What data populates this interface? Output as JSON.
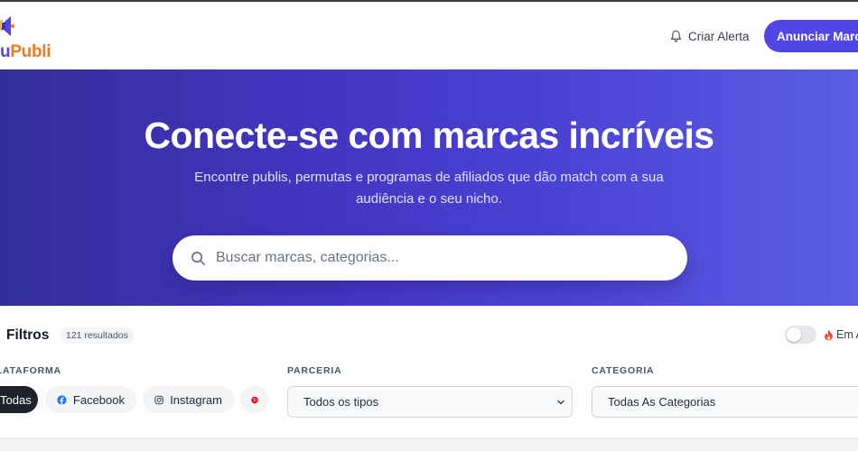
{
  "header": {
    "logo_text_prefix": "u",
    "logo_text": "Publi",
    "alert_label": "Criar Alerta",
    "announce_label": "Anunciar Marca"
  },
  "hero": {
    "title": "Conecte-se com marcas incríveis",
    "subtitle": "Encontre publis, permutas e programas de afiliados que dão match com a sua audiência e o seu nicho.",
    "search_placeholder": "Buscar marcas, categorias..."
  },
  "filters": {
    "title": "Filtros",
    "results": "121 resultados",
    "hot_toggle_label": "Em Alta",
    "platform_label": "PLATAFORMA",
    "partnership_label": "PARCERIA",
    "category_label": "CATEGORIA",
    "platforms": [
      {
        "label": "Todas",
        "icon": "none",
        "active": true
      },
      {
        "label": "Facebook",
        "icon": "facebook-icon"
      },
      {
        "label": "Instagram",
        "icon": "instagram-icon"
      },
      {
        "label": "",
        "icon": "pinterest-icon"
      }
    ],
    "partnership_value": "Todos os tipos",
    "category_value": "Todas As Categorias"
  },
  "colors": {
    "brand": "#4f46e5",
    "logo_orange": "#f07b1e",
    "hero_start": "#332f99",
    "hero_end": "#5a5ee4",
    "active_chip": "#1f2329",
    "facebook": "#1877f2",
    "pinterest": "#e60023",
    "flame": "#ef4444"
  }
}
